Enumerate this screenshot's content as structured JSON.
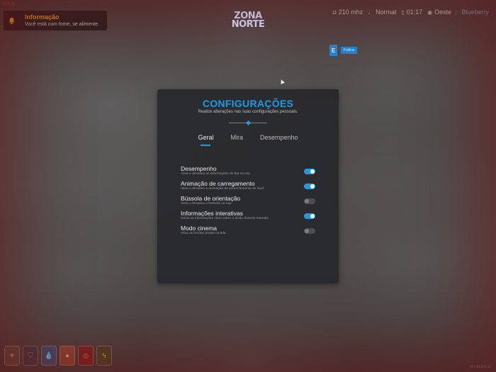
{
  "corner_tag": "10Ug",
  "notification": {
    "icon": "bell-icon",
    "title": "Informação",
    "message": "Você está com fome, se alimente.",
    "accent": "#f0a020"
  },
  "logo": {
    "line1": "ZONA",
    "line2": "NORTE"
  },
  "status": {
    "radio": "210 mhz",
    "voice": "Normal",
    "time": "01:17",
    "direction": "Oeste",
    "separator": "|",
    "server": "Blueberry"
  },
  "keyhint": {
    "key": "E",
    "label": "Fotica"
  },
  "panel": {
    "title": "CONFIGURAÇÕES",
    "subtitle": "Realize alterações nas suas configurações pessoais.",
    "accent": "#1e9be6",
    "tabs": [
      {
        "label": "Geral",
        "active": true
      },
      {
        "label": "Mira",
        "active": false
      },
      {
        "label": "Desempenho",
        "active": false
      }
    ],
    "options": [
      {
        "name": "Desempenho",
        "desc": "Ativa o desativa as informações de fps na tuçi.",
        "enabled": true
      },
      {
        "name": "Animação de carregamento",
        "desc": "Ativa o desativa a animação de preenchimento do loud.",
        "enabled": true
      },
      {
        "name": "Bússola de orientação",
        "desc": "Ativa o desativa a bússola na tuçi.",
        "enabled": false
      },
      {
        "name": "Informações interativas",
        "desc": "Deixa as informações claro sobre o ácido durante interatis.",
        "enabled": true
      },
      {
        "name": "Modo cinema",
        "desc": "Ativa as bordas pretas na tela.",
        "enabled": false
      }
    ]
  },
  "hud": [
    {
      "icon": "health-icon",
      "color": "#c48a6a"
    },
    {
      "icon": "armor-icon",
      "color": "#8a7f9a"
    },
    {
      "icon": "water-icon",
      "color": "#8fb6e8"
    },
    {
      "icon": "food-icon",
      "color": "#e8a77a"
    },
    {
      "icon": "stress-icon",
      "color": "#d85050"
    },
    {
      "icon": "stamina-icon",
      "color": "#d8c040"
    }
  ],
  "watermark": "RTSOULS"
}
